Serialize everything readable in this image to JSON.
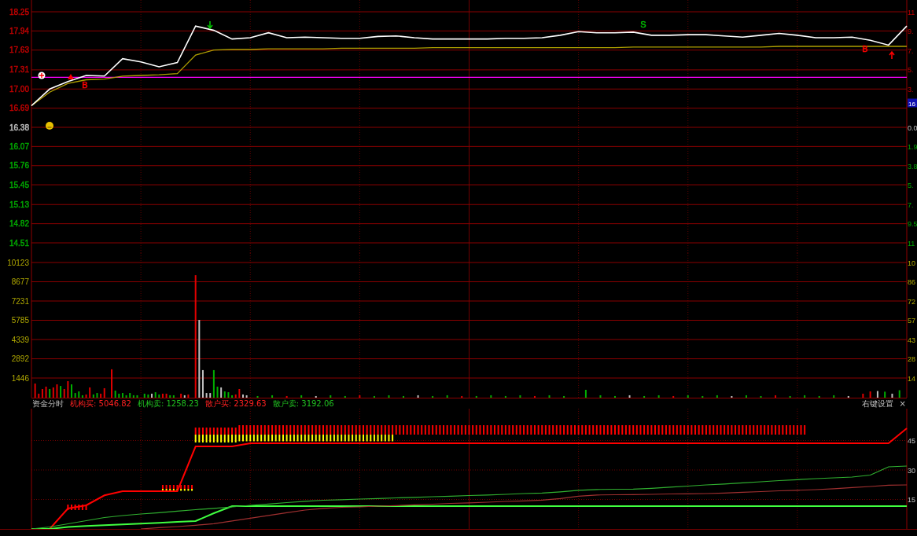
{
  "price_panel": {
    "chart_data": {
      "type": "line",
      "categories": [
        null,
        null,
        null,
        null,
        null,
        null,
        null,
        null,
        null,
        null,
        null,
        null,
        null,
        null,
        null,
        null,
        null,
        null,
        null,
        null,
        null,
        null,
        null,
        null,
        null,
        null,
        null,
        null,
        null,
        null,
        null,
        null,
        null,
        null,
        null,
        null,
        null,
        null,
        null,
        null,
        null,
        null,
        null,
        null,
        null,
        null,
        null,
        null,
        null
      ],
      "ylim": [
        14.51,
        18.25
      ],
      "yticks": [
        {
          "value": 18.25,
          "label": "18.25"
        },
        {
          "value": 17.94,
          "label": "17.94"
        },
        {
          "value": 17.63,
          "label": "17.63"
        },
        {
          "value": 17.31,
          "label": "17.31"
        },
        {
          "value": 17.0,
          "label": "17.00"
        },
        {
          "value": 16.69,
          "label": "16.69"
        },
        {
          "value": 16.38,
          "label": "16.38"
        },
        {
          "value": 16.07,
          "label": "16.07"
        },
        {
          "value": 15.76,
          "label": "15.76"
        },
        {
          "value": 15.45,
          "label": "15.45"
        },
        {
          "value": 15.13,
          "label": "15.13"
        },
        {
          "value": 14.82,
          "label": "14.82"
        },
        {
          "value": 14.51,
          "label": "14.51"
        }
      ],
      "grid": true,
      "series": [
        {
          "color": "#ff00ff",
          "values": [
            17.19,
            17.19,
            17.19,
            17.19,
            17.19,
            17.19,
            17.19,
            17.19,
            17.19,
            17.19,
            17.19,
            17.19,
            17.19,
            17.19,
            17.19,
            17.19,
            17.19,
            17.19,
            17.19,
            17.19,
            17.19,
            17.19,
            17.19,
            17.19,
            17.19,
            17.19,
            17.19,
            17.19,
            17.19,
            17.19,
            17.19,
            17.19,
            17.19,
            17.19,
            17.19,
            17.19,
            17.19,
            17.19,
            17.19,
            17.19,
            17.19,
            17.19,
            17.19,
            17.19,
            17.19,
            17.19,
            17.19,
            17.19,
            17.19
          ]
        },
        {
          "color": "#b0a000",
          "values": [
            16.73,
            16.95,
            17.09,
            17.15,
            17.16,
            17.21,
            17.22,
            17.23,
            17.25,
            17.55,
            17.63,
            17.64,
            17.64,
            17.65,
            17.65,
            17.65,
            17.65,
            17.66,
            17.66,
            17.66,
            17.66,
            17.66,
            17.67,
            17.67,
            17.67,
            17.67,
            17.67,
            17.67,
            17.67,
            17.67,
            17.67,
            17.67,
            17.67,
            17.68,
            17.68,
            17.68,
            17.68,
            17.68,
            17.68,
            17.68,
            17.68,
            17.69,
            17.69,
            17.69,
            17.69,
            17.69,
            17.69,
            17.69,
            17.69
          ]
        },
        {
          "color": "#ffffff",
          "values": [
            16.73,
            17.0,
            17.12,
            17.22,
            17.21,
            17.49,
            17.44,
            17.36,
            17.43,
            18.02,
            17.95,
            17.81,
            17.83,
            17.91,
            17.83,
            17.84,
            17.83,
            17.82,
            17.82,
            17.85,
            17.86,
            17.83,
            17.81,
            17.81,
            17.81,
            17.81,
            17.82,
            17.82,
            17.83,
            17.87,
            17.93,
            17.91,
            17.91,
            17.92,
            17.87,
            17.87,
            17.88,
            17.88,
            17.86,
            17.84,
            17.87,
            17.9,
            17.87,
            17.83,
            17.83,
            17.84,
            17.79,
            17.71,
            18.02
          ]
        }
      ]
    },
    "tick_styles": [
      {
        "color": "#c00000"
      },
      {
        "color": "#c00000"
      },
      {
        "color": "#c00000"
      },
      {
        "color": "#c00000"
      },
      {
        "color": "#c00000"
      },
      {
        "color": "#c00000"
      },
      {
        "color": "#c0c0c0"
      },
      {
        "color": "#00a800"
      },
      {
        "color": "#00a800"
      },
      {
        "color": "#00a800"
      },
      {
        "color": "#00a800"
      },
      {
        "color": "#00a800"
      },
      {
        "color": "#00a800"
      }
    ],
    "signals": [
      {
        "kind": "plus"
      },
      {
        "kind": "triangle"
      },
      {
        "kind": "text",
        "text": "B",
        "color": "#ff0000"
      },
      {
        "kind": "emoji"
      },
      {
        "kind": "down-arrow",
        "color": "#00c000"
      },
      {
        "kind": "text",
        "text": "S",
        "color": "#00c000"
      },
      {
        "kind": "text",
        "text": "B",
        "color": "#ff0000"
      },
      {
        "kind": "up-arrow",
        "color": "#ff0000"
      }
    ],
    "right_axis": [
      {
        "label": "11"
      },
      {
        "label": "9."
      },
      {
        "label": "7."
      },
      {
        "label": "5."
      },
      {
        "label": "3."
      },
      {
        "label": "16",
        "kind": "flag",
        "color": "#1010b0"
      },
      {
        "label": "0.0"
      },
      {
        "label": "1.9"
      },
      {
        "label": "3.8"
      },
      {
        "label": "5."
      },
      {
        "label": "7."
      },
      {
        "label": "9.5"
      },
      {
        "label": "11"
      }
    ]
  },
  "volume_panel": {
    "axis_labels": [
      "10123",
      "8677",
      "7231",
      "5785",
      "4339",
      "2892",
      "1446"
    ],
    "right_axis": [
      "10",
      "86",
      "72",
      "57",
      "43",
      "28",
      "14"
    ]
  },
  "indicator_panel": {
    "title": "资金分时",
    "readouts": [
      {
        "text": "机构买: 5046.82",
        "color": "#ff2020"
      },
      {
        "text": "机构卖: 1258.23",
        "color": "#20c020"
      },
      {
        "text": "散户买: 2329.63",
        "color": "#ff2020"
      },
      {
        "text": "散户卖: 3192.06",
        "color": "#20c020"
      }
    ],
    "settings_label": "右键设置",
    "close_label": "×",
    "chart_data": {
      "type": "line",
      "categories": [
        null,
        null,
        null,
        null,
        null,
        null,
        null,
        null,
        null,
        null,
        null,
        null,
        null,
        null,
        null,
        null,
        null,
        null,
        null,
        null,
        null,
        null,
        null,
        null,
        null,
        null,
        null,
        null,
        null,
        null,
        null,
        null,
        null,
        null,
        null,
        null,
        null,
        null,
        null,
        null,
        null,
        null,
        null,
        null,
        null,
        null,
        null,
        null,
        null
      ],
      "ylim": [
        0,
        61.2
      ],
      "yticks": [
        {
          "value": 45,
          "label": "45"
        },
        {
          "value": 30,
          "label": "30"
        },
        {
          "value": 15,
          "label": "15"
        }
      ],
      "grid": true,
      "series": [
        {
          "color": "#ff0000",
          "values": [
            0,
            0,
            10.4,
            12,
            17.1,
            19.2,
            19.2,
            19.2,
            19.2,
            42,
            42,
            42,
            43.6,
            43.6,
            43.6,
            43.6,
            43.6,
            43.6,
            43.6,
            43.6,
            43.6,
            43.6,
            43.6,
            43.6,
            43.6,
            43.6,
            43.6,
            43.6,
            43.6,
            43.6,
            43.6,
            43.6,
            43.6,
            43.6,
            43.6,
            43.6,
            43.6,
            43.6,
            43.6,
            43.6,
            43.6,
            43.6,
            43.6,
            43.6,
            43.6,
            43.6,
            43.6,
            43.6,
            51.2
          ]
        },
        {
          "color": "#40ff40",
          "values": [
            0,
            0,
            1.0,
            1.5,
            1.9,
            2.3,
            2.7,
            3.1,
            3.6,
            4.0,
            8.0,
            11.6,
            11.6,
            11.6,
            11.6,
            11.6,
            11.6,
            11.6,
            11.6,
            11.6,
            11.6,
            11.6,
            11.6,
            11.6,
            11.6,
            11.6,
            11.6,
            11.6,
            11.6,
            11.6,
            11.6,
            11.6,
            11.6,
            11.6,
            11.6,
            11.6,
            11.6,
            11.6,
            11.6,
            11.6,
            11.6,
            11.6,
            11.6,
            11.6,
            11.6,
            11.6,
            11.6,
            11.6,
            11.6
          ]
        },
        {
          "color": "#30b030",
          "values": [
            0,
            1.0,
            2.6,
            4.2,
            5.8,
            6.8,
            7.6,
            8.3,
            9.1,
            9.8,
            10.5,
            11.2,
            12.0,
            12.7,
            13.4,
            14.1,
            14.6,
            14.9,
            15.2,
            15.5,
            15.8,
            16.1,
            16.4,
            16.7,
            17.0,
            17.3,
            17.6,
            18.0,
            18.3,
            18.9,
            19.7,
            20.1,
            20.2,
            20.3,
            20.7,
            21.3,
            21.8,
            22.4,
            22.9,
            23.5,
            24.0,
            24.6,
            25.1,
            25.6,
            26.0,
            26.4,
            27.4,
            31.6,
            32.0
          ]
        },
        {
          "color": "#a03030",
          "values": [
            null,
            null,
            null,
            null,
            null,
            null,
            0,
            0.7,
            1.2,
            1.9,
            2.7,
            4.1,
            5.5,
            6.9,
            8.3,
            9.6,
            10.5,
            11.0,
            11.2,
            11.6,
            11.9,
            12.3,
            12.6,
            13.0,
            13.3,
            13.6,
            14.0,
            14.3,
            14.7,
            15.5,
            16.7,
            17.3,
            17.4,
            17.5,
            17.6,
            17.8,
            17.9,
            18.0,
            18.3,
            18.7,
            19.0,
            19.4,
            19.7,
            20.0,
            20.5,
            21.1,
            21.6,
            22.3,
            22.4
          ]
        }
      ]
    }
  }
}
